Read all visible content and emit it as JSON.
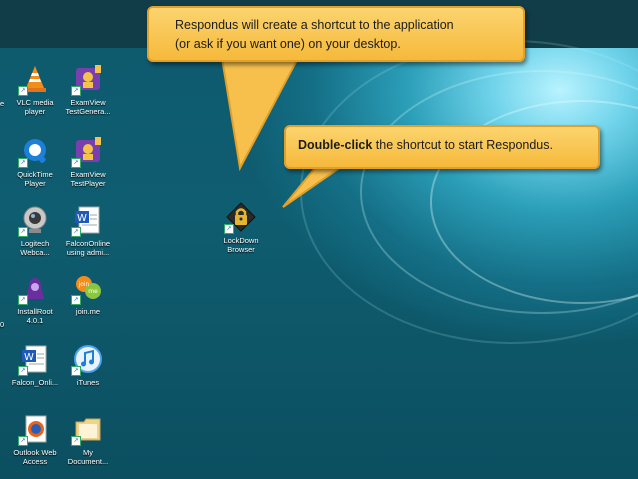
{
  "callouts": {
    "top": {
      "line1": "Respondus will create a shortcut to the application",
      "line2": "(or ask if you want one) on your desktop."
    },
    "middle": {
      "bold": "Double-click",
      "rest": " the shortcut to start Respondus."
    }
  },
  "edge_labels": {
    "e": "e",
    "zero": "0"
  },
  "desktop_icons": [
    {
      "name": "VLC media player",
      "line1": "VLC media",
      "line2": "player",
      "icon": "vlc-cone-icon"
    },
    {
      "name": "ExamView TestGenerator",
      "line1": "ExamView",
      "line2": "TestGenera...",
      "icon": "examview-testgenerator-icon"
    },
    {
      "name": "QuickTime Player",
      "line1": "QuickTime",
      "line2": "Player",
      "icon": "quicktime-icon"
    },
    {
      "name": "ExamView TestPlayer",
      "line1": "ExamView",
      "line2": "TestPlayer",
      "icon": "examview-testplayer-icon"
    },
    {
      "name": "Logitech Webcam",
      "line1": "Logitech",
      "line2": "Webca...",
      "icon": "webcam-icon"
    },
    {
      "name": "FalconOnline using admin",
      "line1": "FalconOnline",
      "line2": "using admi...",
      "icon": "word-document-icon"
    },
    {
      "name": "LockDown Browser",
      "line1": "LockDown",
      "line2": "Browser",
      "icon": "lockdown-browser-icon"
    },
    {
      "name": "InstallRoot 4.0.1",
      "line1": "InstallRoot",
      "line2": "4.0.1",
      "icon": "installroot-icon"
    },
    {
      "name": "join.me",
      "line1": "join.me",
      "line2": "",
      "icon": "joinme-icon"
    },
    {
      "name": "Falcon_Online",
      "line1": "Falcon_Onli...",
      "line2": "",
      "icon": "word-document-icon"
    },
    {
      "name": "iTunes",
      "line1": "iTunes",
      "line2": "",
      "icon": "itunes-icon"
    },
    {
      "name": "Outlook Web Access",
      "line1": "Outlook Web",
      "line2": "Access",
      "icon": "firefox-icon"
    },
    {
      "name": "My Documents",
      "line1": "My",
      "line2": "Document...",
      "icon": "folder-icon"
    }
  ],
  "colors": {
    "callout_fill": "#f6b93b",
    "callout_border": "#e2a028",
    "desktop_teal": "#0f5d70"
  }
}
